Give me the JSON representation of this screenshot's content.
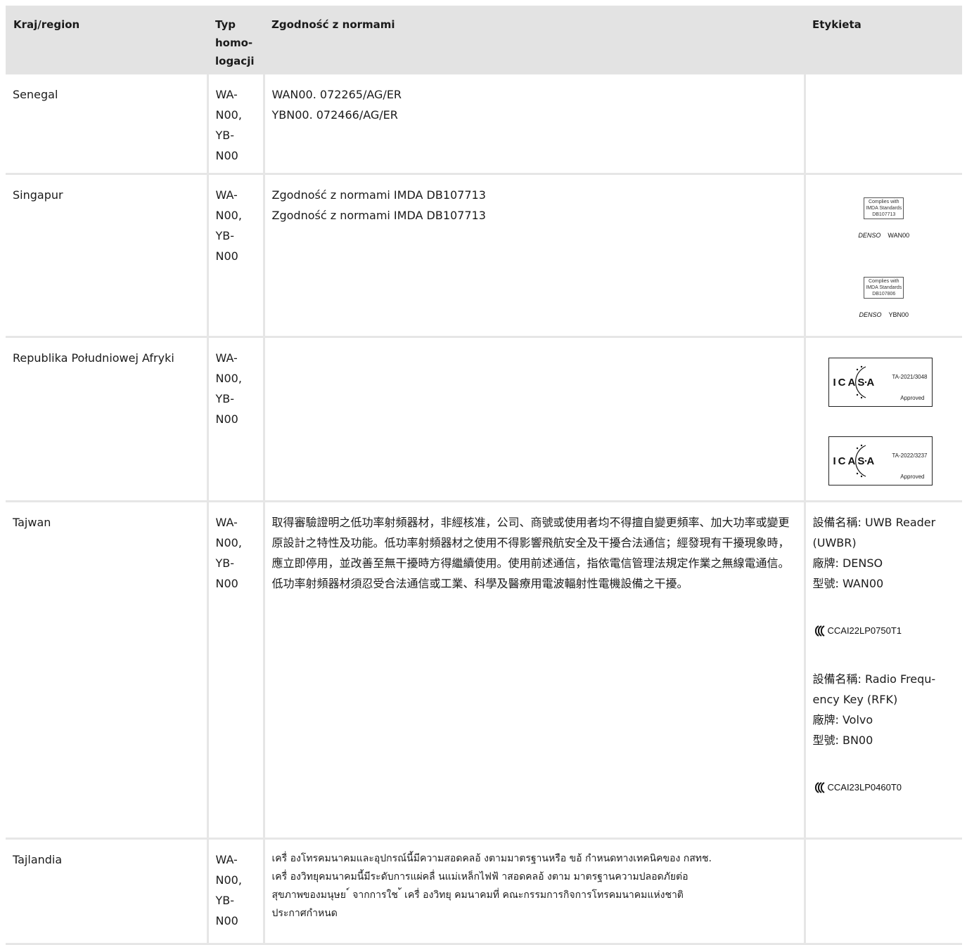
{
  "table": {
    "headers": [
      "Kraj/region",
      "Typ homo-logacji",
      "Zgodność z normami",
      "Etykieta"
    ],
    "header_type_lines": [
      "Typ",
      "homo-",
      "logacji"
    ],
    "rows": [
      {
        "country": "Senegal",
        "type_lines": [
          "WA-",
          "N00,",
          "YB-",
          "N00"
        ],
        "norms": [
          "WAN00. 072265/AG/ER",
          "YBN00. 072466/AG/ER"
        ]
      },
      {
        "country": "Singapur",
        "type_lines": [
          "WA-",
          "N00,",
          "YB-",
          "N00"
        ],
        "norms": [
          "Zgodność z normami IMDA DB107713",
          "Zgodność z normami IMDA DB107713"
        ],
        "labels": [
          {
            "l1": "Complies with",
            "l2": "IMDA Standards",
            "l3": "DB107713",
            "brand": "DENSO",
            "model": "WAN00"
          },
          {
            "l1": "Complies with",
            "l2": "IMDA Standards",
            "l3": "DB107806",
            "brand": "DENSO",
            "model": "YBN00"
          }
        ]
      },
      {
        "country": "Republika Południowej Afryki",
        "type_lines": [
          "WA-",
          "N00,",
          "YB-",
          "N00"
        ],
        "labels": [
          {
            "logo_text": "ICASA",
            "number": "TA-2021/3048",
            "status": "Approved"
          },
          {
            "logo_text": "ICASA",
            "number": "TA-2022/3237",
            "status": "Approved"
          }
        ]
      },
      {
        "country": "Tajwan",
        "type_lines": [
          "WA-",
          "N00,",
          "YB-",
          "N00"
        ],
        "norm_text": "取得審驗證明之低功率射頻器材，非經核准，公司、商號或使用者均不得擅自變更頻率、加大功率或變更原設計之特性及功能。低功率射頻器材之使用不得影響飛航安全及干擾合法通信；經發現有干擾現象時，應立即停用，並改善至無干擾時方得繼續使用。使用前述通信，指依電信管理法規定作業之無線電通信。低功率射頻器材須忍受合法通信或工業、科學及醫療用電波輻射性電機設備之干擾。",
        "label_groups": [
          {
            "lines": [
              "設備名稱: UWB Reader (UWBR)",
              "廠牌: DENSO",
              "型號: WAN00"
            ],
            "ncc": "CCAI22LP0750T1"
          },
          {
            "lines": [
              "設備名稱: Radio Frequ-ency Key (RFK)",
              "廠牌: Volvo",
              "型號: BN00"
            ],
            "ncc": "CCAI23LP0460T0"
          }
        ]
      },
      {
        "country": "Tajlandia",
        "type_lines": [
          "WA-",
          "N00,",
          "YB-",
          "N00"
        ],
        "norm_lines": [
          "เครื่ องโทรคมนาคมและอุปกรณ์นี้มีความสอดคลอ้ งตามมาตรฐานหรือ ขอ้ กำหนดทางเทคนิคของ กสทช.",
          "เครื่ องวิทยุคมนาคมนี้มีระดับการแผ่คลื่ นแม่เหล็กไฟฟ้ าสอดคลอ้ งตาม มาตรฐานความปลอดภัยต่อ",
          "สุขภาพของมนุษย ์ จากการใช ้ เครื่ องวิทยุ คมนาคมที่ คณะกรรมการกิจการโทรคมนาคมแห่งชาติ",
          "ประกาศกำหนด"
        ]
      }
    ]
  }
}
